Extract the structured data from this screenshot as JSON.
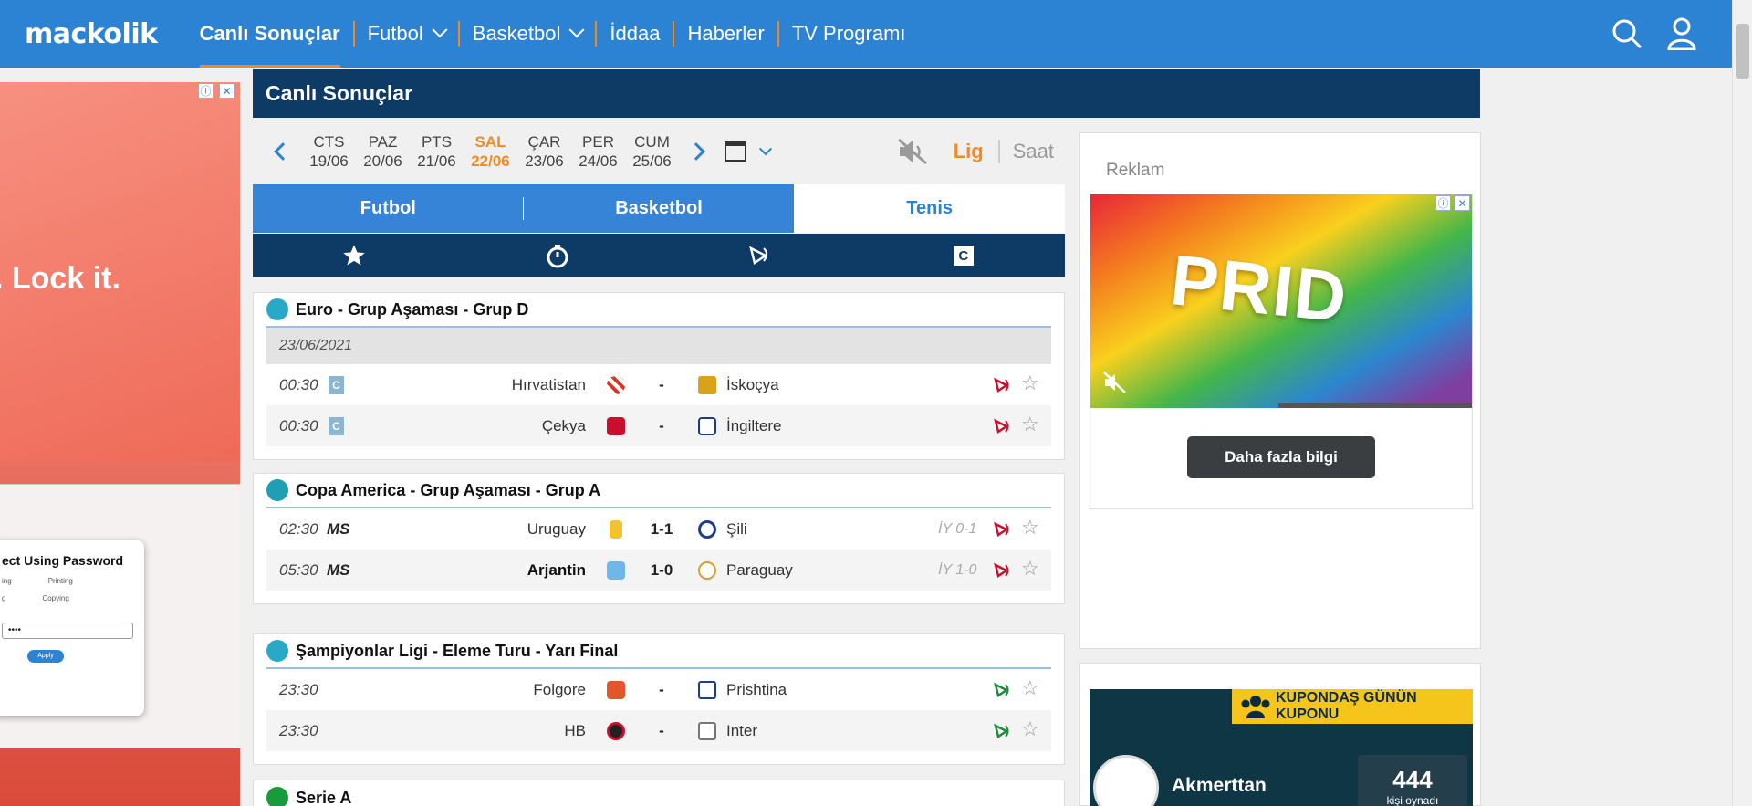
{
  "topnav": {
    "logo": "mackolik",
    "items": [
      "Canlı Sonuçlar",
      "Futbol",
      "Basketbol",
      "İddaa",
      "Haberler",
      "TV Programı"
    ]
  },
  "left_ad": {
    "headline": ". Lock it.",
    "dialog_title": "ect Using Password",
    "options": [
      "ing",
      "Printing",
      "g",
      "Copying"
    ],
    "password": "••••",
    "apply": "Apply"
  },
  "main": {
    "title": "Canlı Sonuçlar",
    "days": [
      {
        "d": "CTS",
        "date": "19/06"
      },
      {
        "d": "PAZ",
        "date": "20/06"
      },
      {
        "d": "PTS",
        "date": "21/06"
      },
      {
        "d": "SAL",
        "date": "22/06"
      },
      {
        "d": "ÇAR",
        "date": "23/06"
      },
      {
        "d": "PER",
        "date": "24/06"
      },
      {
        "d": "CUM",
        "date": "25/06"
      }
    ],
    "sort_lig": "Lig",
    "sort_saat": "Saat",
    "tabs": [
      "Futbol",
      "Basketbol",
      "Tenis"
    ],
    "filter_c": "C"
  },
  "leagues": [
    {
      "name": "Euro - Grup Aşaması - Grup D",
      "date": "23/06/2021",
      "matches": [
        {
          "time": "00:30",
          "badge": "C",
          "home": "Hırvatistan",
          "score": "-",
          "away": "İskoçya"
        },
        {
          "time": "00:30",
          "badge": "C",
          "home": "Çekya",
          "score": "-",
          "away": "İngiltere"
        }
      ]
    },
    {
      "name": "Copa America - Grup Aşaması - Grup A",
      "matches": [
        {
          "time": "02:30",
          "status": "MS",
          "home": "Uruguay",
          "score": "1-1",
          "away": "Şili",
          "iy": "İY 0-1"
        },
        {
          "time": "05:30",
          "status": "MS",
          "home": "Arjantin",
          "score": "1-0",
          "away": "Paraguay",
          "iy": "İY 1-0"
        }
      ]
    },
    {
      "name": "Şampiyonlar Ligi - Eleme Turu - Yarı Final",
      "matches": [
        {
          "time": "23:30",
          "home": "Folgore",
          "score": "-",
          "away": "Prishtina"
        },
        {
          "time": "23:30",
          "home": "HB",
          "score": "-",
          "away": "Inter"
        }
      ]
    },
    {
      "name": "Serie A"
    }
  ],
  "right": {
    "reklam": "Reklam",
    "ad_text": "PRID",
    "ad_button": "Daha fazla bilgi",
    "kupon_title": "KUPONDAŞ GÜNÜN KUPONU",
    "kupon_user": "Akmerttan",
    "kupon_count": "444",
    "kupon_count_label": "kişi oynadı"
  },
  "colors": {
    "nav_blue": "#2c83d4",
    "dark_blue": "#0e3a66",
    "accent_orange": "#f08a24",
    "kupon_yellow": "#f5c51b"
  }
}
